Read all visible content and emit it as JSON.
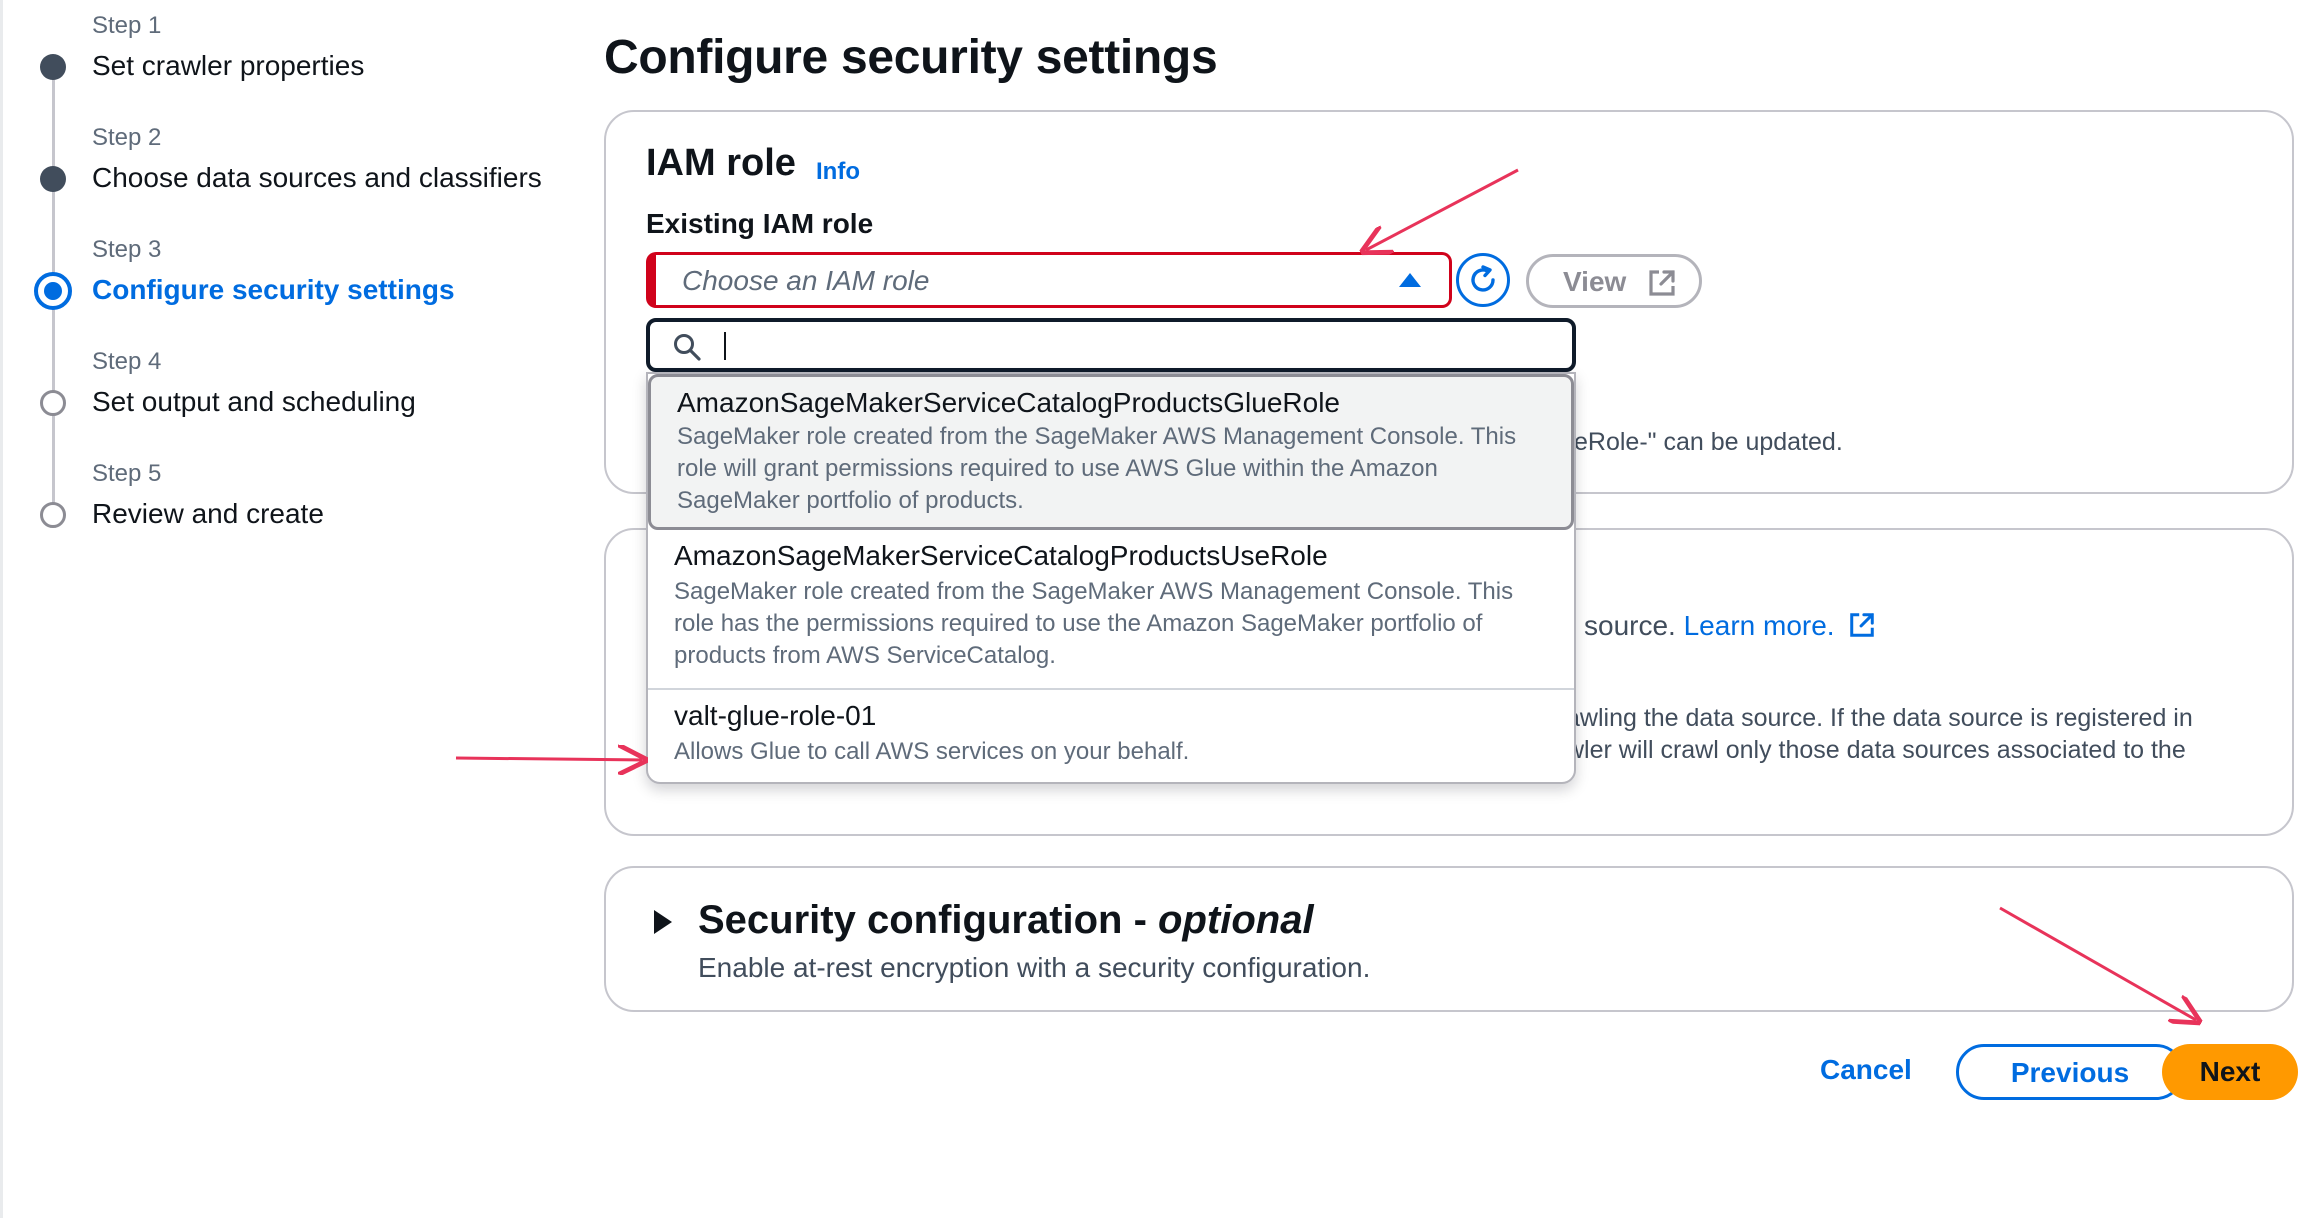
{
  "steps": [
    {
      "caption": "Step 1",
      "title": "Set crawler properties",
      "state": "complete"
    },
    {
      "caption": "Step 2",
      "title": "Choose data sources and classifiers",
      "state": "complete"
    },
    {
      "caption": "Step 3",
      "title": "Configure security settings",
      "state": "current"
    },
    {
      "caption": "Step 4",
      "title": "Set output and scheduling",
      "state": "pending"
    },
    {
      "caption": "Step 5",
      "title": "Review and create",
      "state": "pending"
    }
  ],
  "page_title": "Configure security settings",
  "iam_panel": {
    "title": "IAM role",
    "info_link": "Info",
    "field_label": "Existing IAM role",
    "select_placeholder": "Choose an IAM role",
    "refresh_icon": "refresh-icon",
    "view_button": "View",
    "view_icon": "external-link-icon",
    "hint_fragment": "eRole-\" can be updated."
  },
  "dropdown": {
    "search_icon": "search-icon",
    "search_value": "",
    "options": [
      {
        "title": "AmazonSageMakerServiceCatalogProductsGlueRole",
        "desc_lines": [
          "SageMaker role created from the SageMaker AWS Management Console. This",
          "role will grant permissions required to use AWS Glue within the Amazon",
          "SageMaker portfolio of products."
        ],
        "highlighted": true
      },
      {
        "title": "AmazonSageMakerServiceCatalogProductsUseRole",
        "desc_lines": [
          "SageMaker role created from the SageMaker AWS Management Console. This",
          "role has the permissions required to use the Amazon SageMaker portfolio of",
          "products from AWS ServiceCatalog."
        ],
        "highlighted": false
      },
      {
        "title": "valt-glue-role-01",
        "desc_lines": [
          "Allows Glue to call AWS services on your behalf."
        ],
        "highlighted": false
      }
    ]
  },
  "lake_panel": {
    "line1_fragment": "source.",
    "learn_more": "Learn more.",
    "line2_fragment": "awling the data source. If the data source is registered in",
    "line3_fragment": "wler will crawl only those data sources associated to the"
  },
  "security_panel": {
    "title": "Security configuration - ",
    "title_optional": "optional",
    "description": "Enable at-rest encryption with a security configuration."
  },
  "footer": {
    "cancel": "Cancel",
    "previous": "Previous",
    "next": "Next"
  },
  "colors": {
    "accent": "#006ce0",
    "primary_button": "#ff9900",
    "annotation_arrow": "#e8335a",
    "select_error_border": "#d0021b"
  }
}
